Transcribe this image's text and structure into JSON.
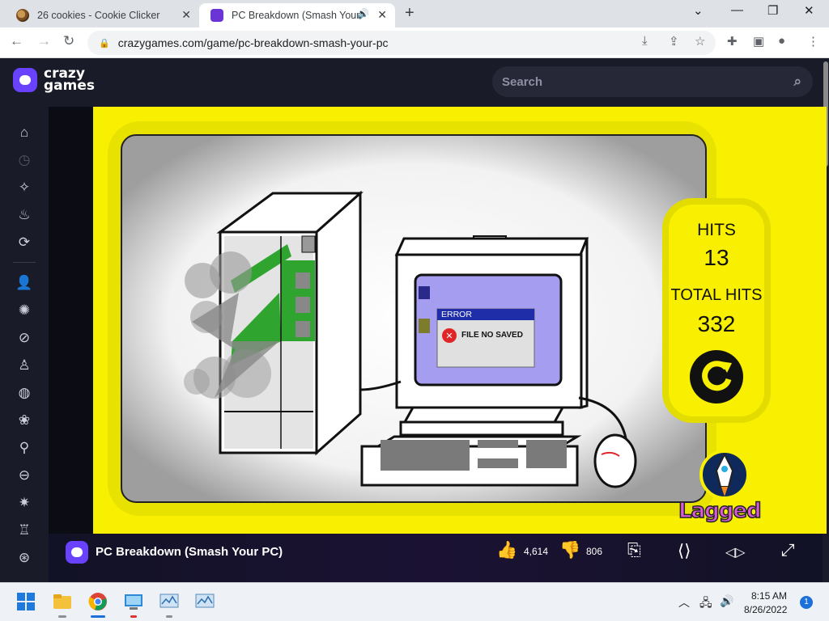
{
  "browser": {
    "tabs": [
      {
        "title": "26 cookies - Cookie Clicker",
        "active": false
      },
      {
        "title": "PC Breakdown (Smash Your",
        "active": true
      }
    ],
    "new_tab_icon": "plus-icon",
    "url": "crazygames.com/game/pc-breakdown-smash-your-pc"
  },
  "site": {
    "logo_line1": "crazy",
    "logo_line2": "games",
    "search_placeholder": "Search"
  },
  "sidebar": {
    "items": [
      "home-icon",
      "recent-icon",
      "new-icon",
      "trending-icon",
      "updated-icon",
      "multiplayer-icon",
      "action-icon",
      "adventure-icon",
      "casual-icon",
      "sports-icon",
      "clicker-icon",
      "bike-icon",
      "car-icon",
      "shooting-icon",
      "io-icon",
      "driving-icon"
    ]
  },
  "game": {
    "hits_label": "HITS",
    "hits_value": "13",
    "total_hits_label": "TOTAL HITS",
    "total_hits_value": "332",
    "error_title": "ERROR",
    "error_message": "FILE NO SAVED",
    "brand": "Lagged"
  },
  "gamebar": {
    "title": "PC Breakdown (Smash Your PC)",
    "likes": "4,614",
    "dislikes": "806"
  },
  "taskbar": {
    "time": "8:15 AM",
    "date": "8/26/2022",
    "notifications": "1"
  },
  "colors": {
    "game_yellow": "#f8f000",
    "site_dark": "#1a1b28",
    "brand_purple": "#6842ff"
  }
}
